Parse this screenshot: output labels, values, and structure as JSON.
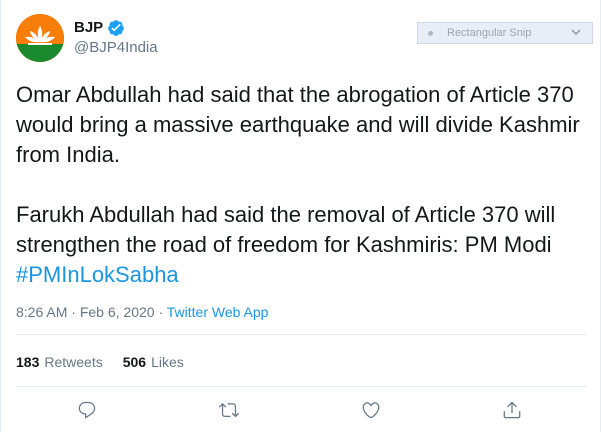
{
  "tweet": {
    "author": {
      "name": "BJP",
      "handle": "@BJP4India",
      "verified": true,
      "avatar_icon": "bjp-lotus-logo",
      "avatar_color": "#f97d09"
    },
    "text": {
      "paragraph1": "Omar Abdullah had said that the abrogation of Article 370 would bring a massive earthquake and will divide Kashmir from India.",
      "paragraph2": "Farukh Abdullah had said the removal of Article 370 will strengthen the road of freedom for Kashmiris: PM Modi",
      "hashtag": "#PMInLokSabha"
    },
    "meta": {
      "time": "8:26 AM",
      "date": "Feb 6, 2020",
      "separator": "·",
      "source": "Twitter Web App"
    },
    "stats": {
      "retweets_count": "183",
      "retweets_label": "Retweets",
      "likes_count": "506",
      "likes_label": "Likes"
    },
    "actions": [
      "reply-icon",
      "retweet-icon",
      "like-icon",
      "share-icon"
    ]
  },
  "overlay": {
    "label": "Rectangular Snip"
  },
  "colors": {
    "link": "#1b95e0",
    "secondary_text": "#657786",
    "verified": "#1da1f2"
  }
}
